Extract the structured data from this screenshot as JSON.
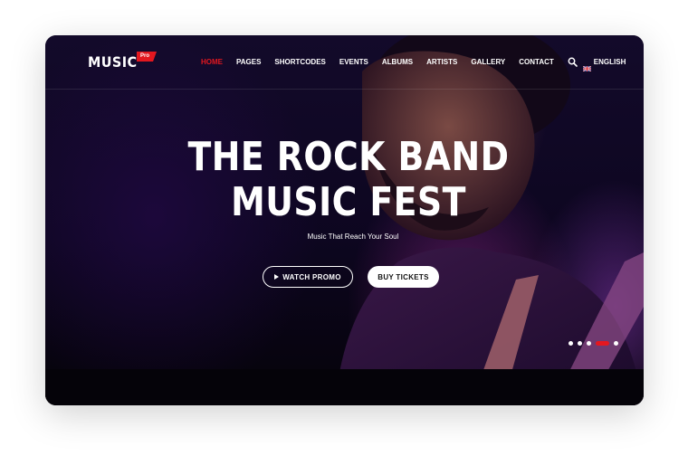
{
  "brand": {
    "name": "MUSIC",
    "badge": "Pro"
  },
  "nav": {
    "items": [
      {
        "label": "HOME",
        "active": true
      },
      {
        "label": "PAGES",
        "active": false
      },
      {
        "label": "SHORTCODES",
        "active": false
      },
      {
        "label": "EVENTS",
        "active": false
      },
      {
        "label": "ALBUMS",
        "active": false
      },
      {
        "label": "ARTISTS",
        "active": false
      },
      {
        "label": "GALLERY",
        "active": false
      },
      {
        "label": "CONTACT",
        "active": false
      }
    ],
    "search_icon": "search-icon",
    "language": {
      "label": "ENGLISH",
      "flag_icon": "uk-flag-icon"
    }
  },
  "hero": {
    "title_line1": "THE ROCK BAND",
    "title_line2": "MUSIC FEST",
    "subtitle": "Music That Reach Your Soul",
    "watch_promo_label": "WATCH PROMO",
    "buy_tickets_label": "BUY TICKETS"
  },
  "slider": {
    "total_slides": 5,
    "active_slide": 4
  },
  "colors": {
    "accent": "#e3171f",
    "background": "#07040c",
    "text": "#ffffff"
  }
}
